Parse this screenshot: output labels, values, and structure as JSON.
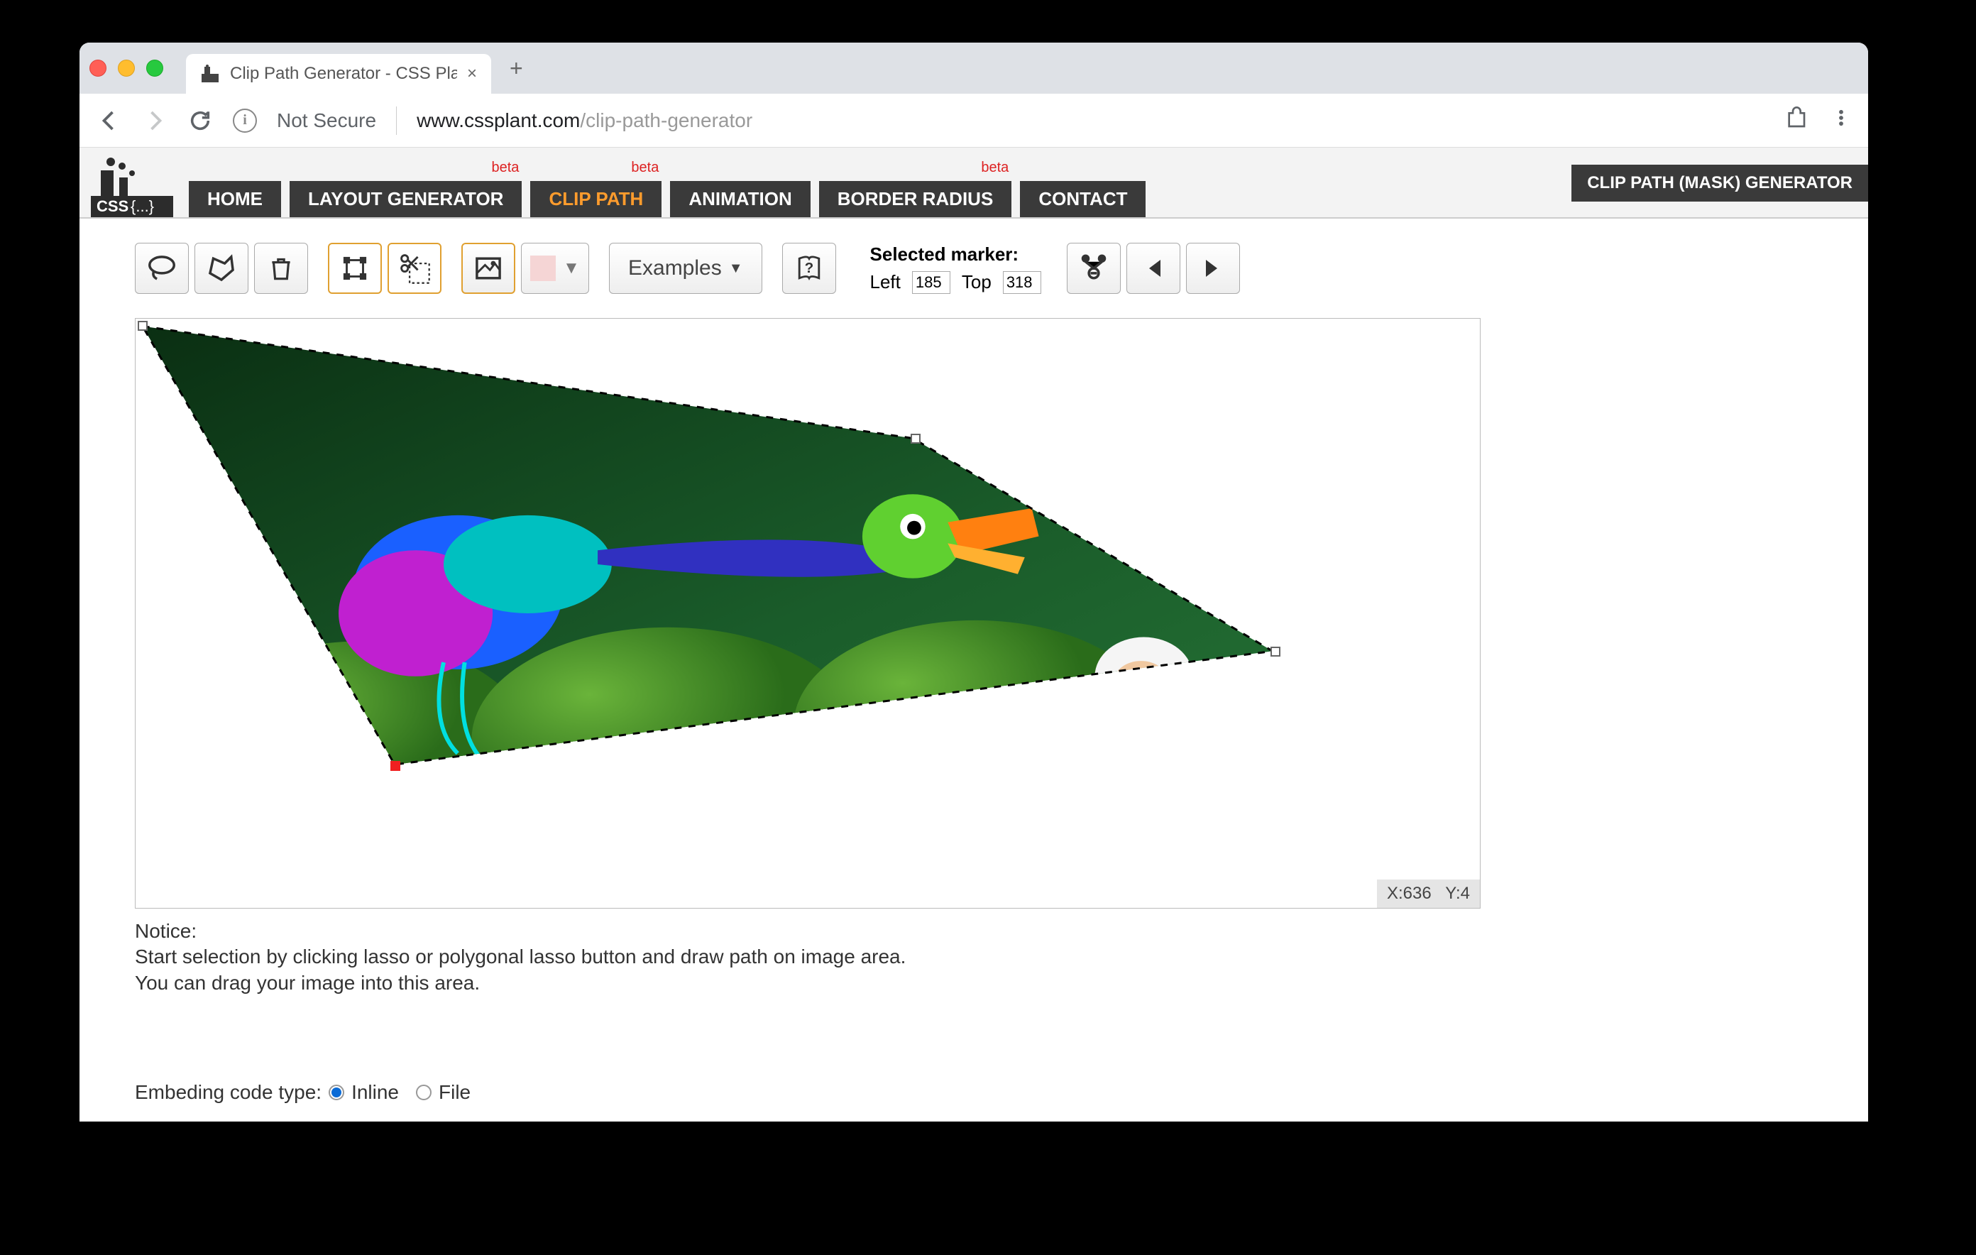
{
  "browser": {
    "tab_title": "Clip Path Generator - CSS Plan",
    "not_secure": "Not Secure",
    "url_host": "www.cssplant.com",
    "url_path": "/clip-path-generator",
    "new_tab": "+",
    "close": "×"
  },
  "site": {
    "logo_text": "CSS {...}",
    "nav": [
      {
        "label": "HOME",
        "badge": ""
      },
      {
        "label": "LAYOUT GENERATOR",
        "badge": "beta"
      },
      {
        "label": "CLIP PATH",
        "badge": "beta"
      },
      {
        "label": "ANIMATION",
        "badge": ""
      },
      {
        "label": "BORDER RADIUS",
        "badge": "beta"
      },
      {
        "label": "CONTACT",
        "badge": ""
      }
    ],
    "title_banner": "CLIP PATH (MASK) GENERATOR"
  },
  "toolbar": {
    "examples": "Examples",
    "selected_marker_title": "Selected marker:",
    "left_label": "Left",
    "left_value": "185",
    "top_label": "Top",
    "top_value": "318"
  },
  "canvas": {
    "coord_x_label": "X:",
    "coord_x": "636",
    "coord_y_label": "Y:",
    "coord_y": "4"
  },
  "notice": {
    "heading": "Notice:",
    "line1": "Start selection by clicking lasso or polygonal lasso button and draw path on image area.",
    "line2": "You can drag your image into this area."
  },
  "embed": {
    "label": "Embeding code type:",
    "opt1": "Inline",
    "opt2": "File"
  }
}
